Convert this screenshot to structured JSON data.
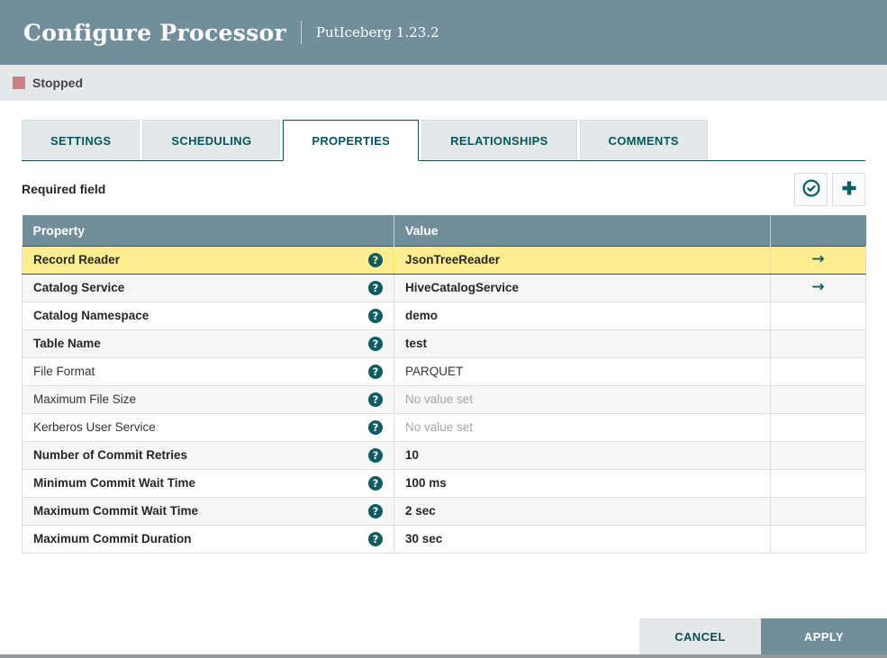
{
  "dialog": {
    "title": "Configure Processor",
    "subtitle": "PutIceberg 1.23.2"
  },
  "status": {
    "label": "Stopped",
    "color": "#ca8186"
  },
  "tabs": [
    {
      "label": "SETTINGS",
      "active": false
    },
    {
      "label": "SCHEDULING",
      "active": false
    },
    {
      "label": "PROPERTIES",
      "active": true
    },
    {
      "label": "RELATIONSHIPS",
      "active": false
    },
    {
      "label": "COMMENTS",
      "active": false
    }
  ],
  "toolbar": {
    "required_label": "Required field",
    "verify_icon": "check-circle-icon",
    "add_icon": "plus-icon"
  },
  "icons": {
    "help_glyph": "?",
    "goto_arrow_glyph": "→"
  },
  "table": {
    "columns": {
      "property": "Property",
      "value": "Value"
    },
    "rows": [
      {
        "property": "Record Reader",
        "value": "JsonTreeReader",
        "required": true,
        "selected": true,
        "has_arrow": true,
        "empty": false
      },
      {
        "property": "Catalog Service",
        "value": "HiveCatalogService",
        "required": true,
        "selected": false,
        "has_arrow": true,
        "empty": false
      },
      {
        "property": "Catalog Namespace",
        "value": "demo",
        "required": true,
        "selected": false,
        "has_arrow": false,
        "empty": false
      },
      {
        "property": "Table Name",
        "value": "test",
        "required": true,
        "selected": false,
        "has_arrow": false,
        "empty": false
      },
      {
        "property": "File Format",
        "value": "PARQUET",
        "required": false,
        "selected": false,
        "has_arrow": false,
        "empty": false
      },
      {
        "property": "Maximum File Size",
        "value": "No value set",
        "required": false,
        "selected": false,
        "has_arrow": false,
        "empty": true
      },
      {
        "property": "Kerberos User Service",
        "value": "No value set",
        "required": false,
        "selected": false,
        "has_arrow": false,
        "empty": true
      },
      {
        "property": "Number of Commit Retries",
        "value": "10",
        "required": true,
        "selected": false,
        "has_arrow": false,
        "empty": false
      },
      {
        "property": "Minimum Commit Wait Time",
        "value": "100 ms",
        "required": true,
        "selected": false,
        "has_arrow": false,
        "empty": false
      },
      {
        "property": "Maximum Commit Wait Time",
        "value": "2 sec",
        "required": true,
        "selected": false,
        "has_arrow": false,
        "empty": false
      },
      {
        "property": "Maximum Commit Duration",
        "value": "30 sec",
        "required": true,
        "selected": false,
        "has_arrow": false,
        "empty": false
      }
    ]
  },
  "footer": {
    "cancel_label": "CANCEL",
    "apply_label": "APPLY"
  },
  "colors": {
    "header_slate": "#728e9b",
    "teal": "#07555a",
    "statusbar_bg": "#e3e8eb",
    "selected_row": "#ffee8f",
    "alt_row": "#f4f6f7"
  }
}
